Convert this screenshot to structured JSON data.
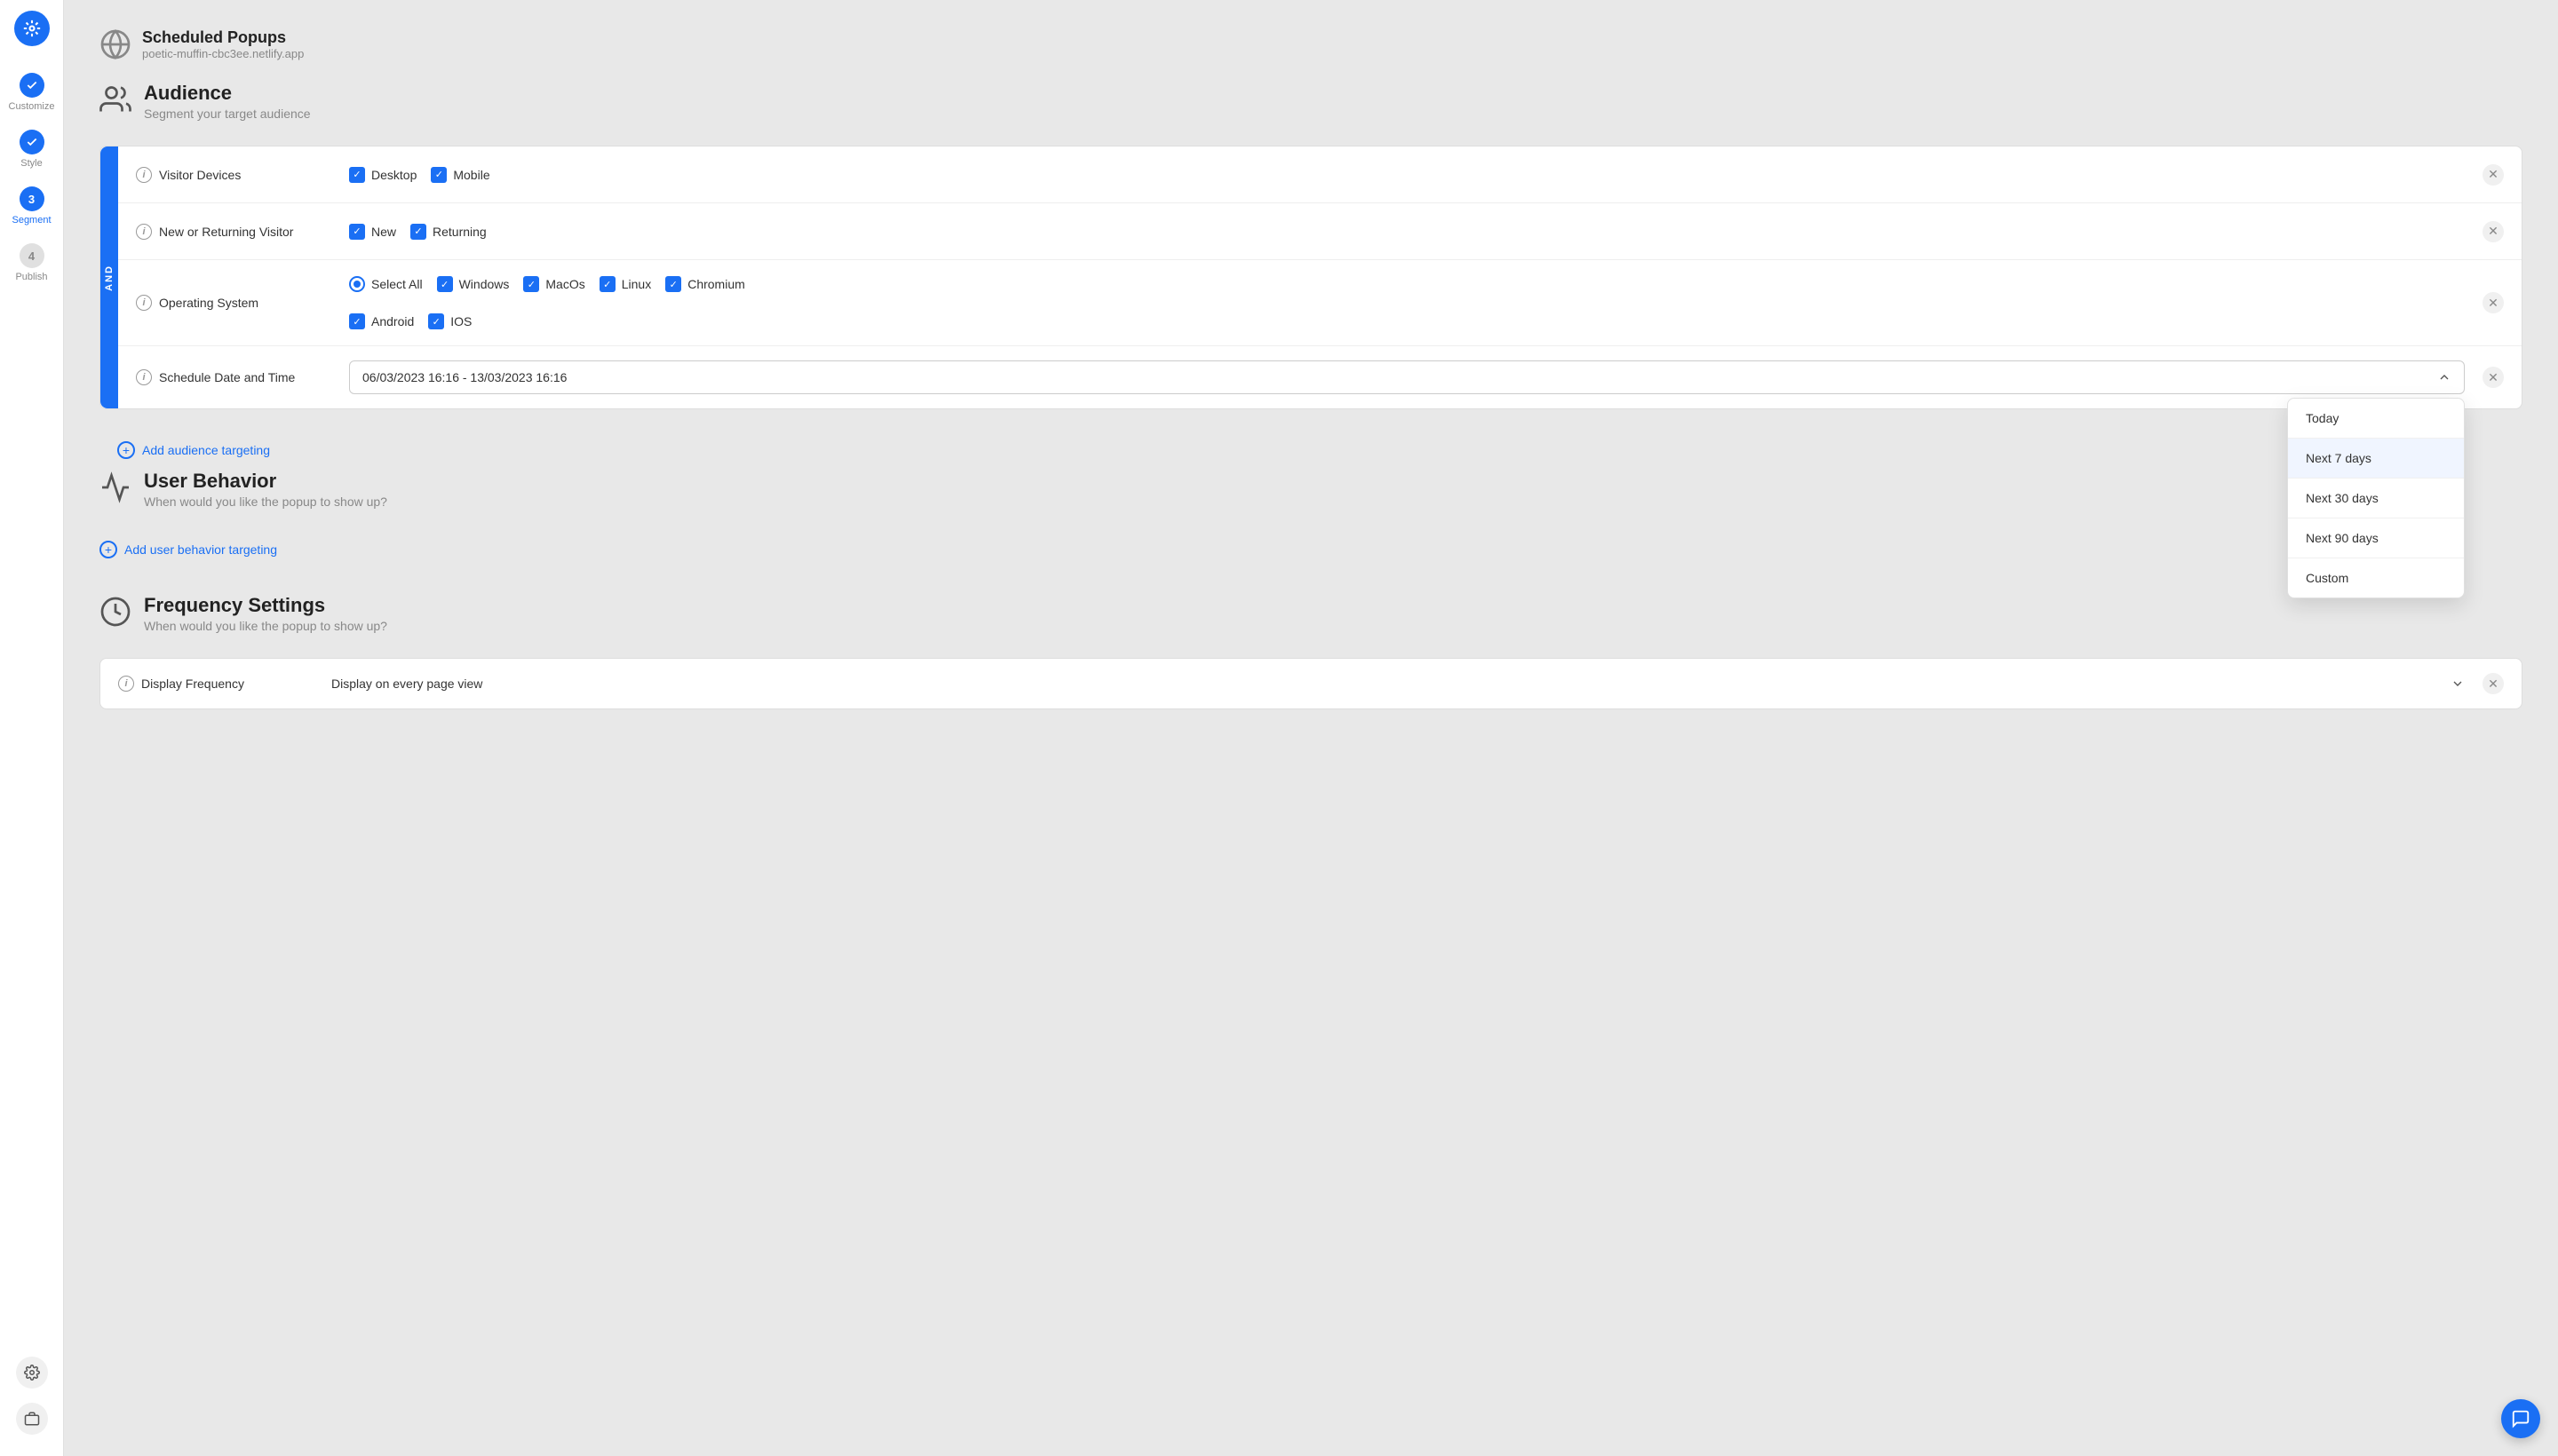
{
  "app": {
    "logo_label": "App Logo"
  },
  "sidebar": {
    "items": [
      {
        "id": "customize",
        "label": "Customize",
        "step": "✓",
        "state": "done"
      },
      {
        "id": "style",
        "label": "Style",
        "step": "✓",
        "state": "done"
      },
      {
        "id": "segment",
        "label": "Segment",
        "step": "3",
        "state": "active"
      },
      {
        "id": "publish",
        "label": "Publish",
        "step": "4",
        "state": "inactive"
      }
    ],
    "settings_label": "Settings"
  },
  "top_bar": {
    "title": "Scheduled Popups",
    "url": "poetic-muffin-cbc3ee.netlify.app"
  },
  "audience": {
    "title": "Audience",
    "subtitle": "Segment your target audience",
    "and_label": "AND",
    "rows": [
      {
        "id": "visitor-devices",
        "label": "Visitor Devices",
        "options": [
          {
            "id": "desktop",
            "label": "Desktop",
            "checked": true
          },
          {
            "id": "mobile",
            "label": "Mobile",
            "checked": true
          }
        ]
      },
      {
        "id": "new-or-returning",
        "label": "New or Returning Visitor",
        "options": [
          {
            "id": "new",
            "label": "New",
            "checked": true
          },
          {
            "id": "returning",
            "label": "Returning",
            "checked": true
          }
        ]
      },
      {
        "id": "operating-system",
        "label": "Operating System",
        "options": [
          {
            "id": "select-all",
            "label": "Select All",
            "checked": false,
            "radio": true
          },
          {
            "id": "windows",
            "label": "Windows",
            "checked": true
          },
          {
            "id": "macos",
            "label": "MacOs",
            "checked": true
          },
          {
            "id": "linux",
            "label": "Linux",
            "checked": true
          },
          {
            "id": "chromium",
            "label": "Chromium",
            "checked": true
          },
          {
            "id": "android",
            "label": "Android",
            "checked": true
          },
          {
            "id": "ios",
            "label": "IOS",
            "checked": true
          }
        ]
      },
      {
        "id": "schedule-date",
        "label": "Schedule Date and Time",
        "value": "06/03/2023 16:16 - 13/03/2023 16:16"
      }
    ],
    "add_targeting_label": "Add audience targeting"
  },
  "date_dropdown": {
    "items": [
      {
        "id": "today",
        "label": "Today"
      },
      {
        "id": "next-7",
        "label": "Next 7 days",
        "highlighted": true
      },
      {
        "id": "next-30",
        "label": "Next 30 days"
      },
      {
        "id": "next-90",
        "label": "Next 90 days"
      },
      {
        "id": "custom",
        "label": "Custom"
      }
    ]
  },
  "user_behavior": {
    "title": "User Behavior",
    "subtitle": "When would you like the popup to show up?",
    "add_label": "Add user behavior targeting"
  },
  "frequency": {
    "title": "Frequency Settings",
    "subtitle": "When would you like the popup to show up?",
    "rows": [
      {
        "id": "display-frequency",
        "label": "Display Frequency",
        "value": "Display on every page view"
      }
    ]
  },
  "chat_button": {
    "label": "💬"
  }
}
